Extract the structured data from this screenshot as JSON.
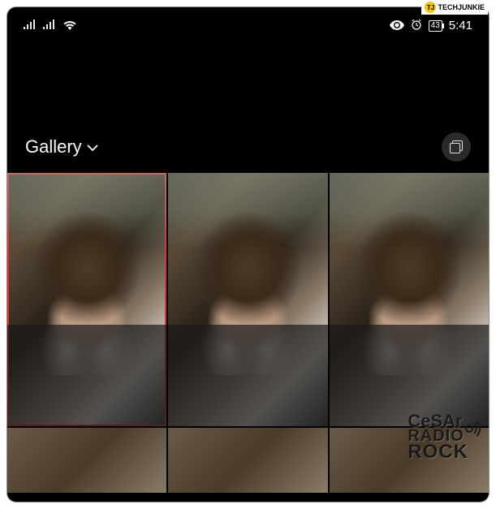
{
  "watermark_top": {
    "logo_text": "TJ",
    "brand": "TECHJUNKIE"
  },
  "status_bar": {
    "battery_percent": "43",
    "time": "5:41"
  },
  "header": {
    "title": "Gallery"
  },
  "photos": {
    "row1": [
      {
        "selected": true
      },
      {
        "selected": false
      },
      {
        "selected": false
      }
    ]
  },
  "watermark_bottom": {
    "line1": "CeSAr",
    "line2": "RADIO",
    "line3": "ROCK"
  }
}
